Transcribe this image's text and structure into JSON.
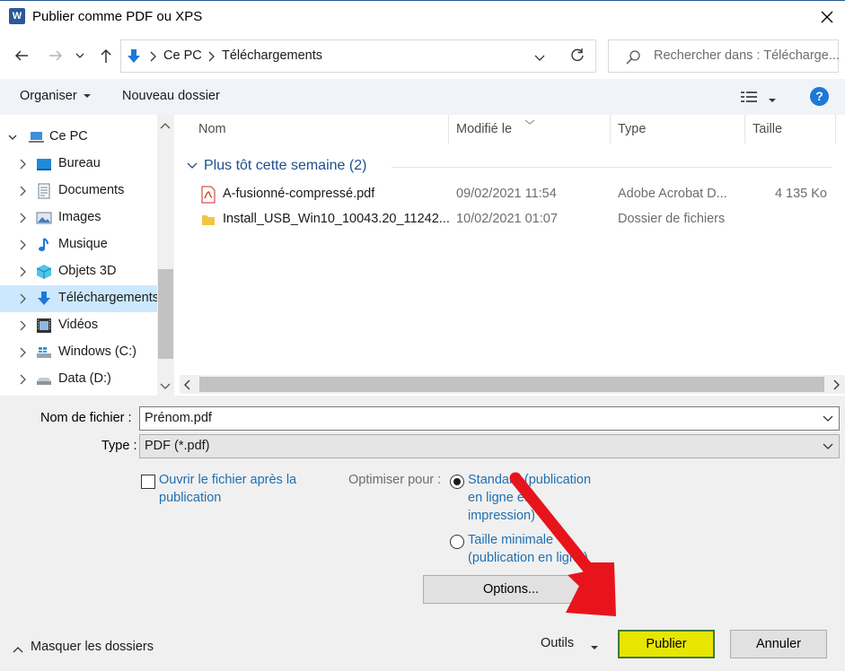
{
  "window": {
    "title": "Publier comme PDF ou XPS",
    "app_icon_letter": "W",
    "accent": "#2b579a"
  },
  "address": {
    "crumbs": [
      "Ce PC",
      "Téléchargements"
    ]
  },
  "search": {
    "placeholder": "Rechercher dans : Télécharge..."
  },
  "toolbar": {
    "organiser": "Organiser",
    "nouveau_dossier": "Nouveau dossier",
    "help": "?"
  },
  "sidebar": {
    "root": "Ce PC",
    "items": [
      {
        "label": "Bureau",
        "icon": "desktop-icon"
      },
      {
        "label": "Documents",
        "icon": "documents-icon"
      },
      {
        "label": "Images",
        "icon": "images-icon"
      },
      {
        "label": "Musique",
        "icon": "music-icon"
      },
      {
        "label": "Objets 3D",
        "icon": "3d-objects-icon"
      },
      {
        "label": "Téléchargements",
        "icon": "downloads-icon",
        "selected": true
      },
      {
        "label": "Vidéos",
        "icon": "videos-icon"
      },
      {
        "label": "Windows (C:)",
        "icon": "windows-drive-icon"
      },
      {
        "label": "Data (D:)",
        "icon": "drive-icon"
      }
    ]
  },
  "filelist": {
    "columns": {
      "name": "Nom",
      "modified": "Modifié le",
      "type": "Type",
      "size": "Taille"
    },
    "group": "Plus tôt cette semaine (2)",
    "rows": [
      {
        "name": "A-fusionné-compressé.pdf",
        "modified": "09/02/2021 11:54",
        "type": "Adobe Acrobat D...",
        "size": "4 135 Ko",
        "icon": "pdf-file-icon"
      },
      {
        "name": "Install_USB_Win10_10043.20_11242...",
        "modified": "10/02/2021 01:07",
        "type": "Dossier de fichiers",
        "size": "",
        "icon": "folder-icon"
      }
    ]
  },
  "form": {
    "filename_label": "Nom de fichier :",
    "filename_value": "Prénom.pdf",
    "type_label": "Type :",
    "type_value": "PDF (*.pdf)",
    "open_after": {
      "line1": "Ouvrir le fichier après la",
      "line2": "publication",
      "checked": false
    },
    "optimize_label": "Optimiser pour :",
    "standard": {
      "line1": "Standard (publication",
      "line2": "en ligne et",
      "line3": "impression)",
      "selected": true
    },
    "minimal": {
      "line1": "Taille minimale",
      "line2": "(publication en ligne)",
      "selected": false
    },
    "options_button": "Options..."
  },
  "footer": {
    "hide_folders": "Masquer les dossiers",
    "tools": "Outils",
    "publish": "Publier",
    "cancel": "Annuler",
    "publish_color": "#e7e600"
  },
  "annotation": {
    "arrow_color": "#e8141c"
  }
}
